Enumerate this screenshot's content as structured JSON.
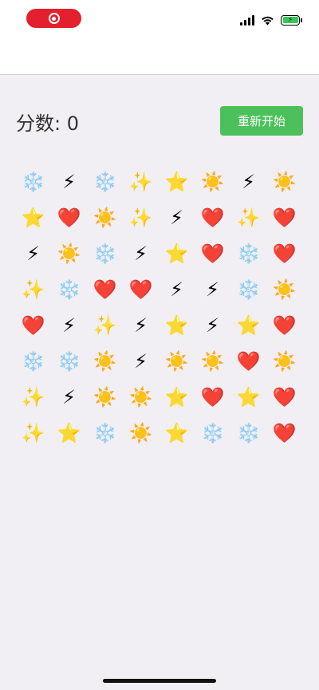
{
  "statusbar": {
    "record_icon": "record-circle-icon",
    "signal_icon": "cellular-signal-icon",
    "wifi_icon": "wifi-icon",
    "battery_icon": "battery-charging-icon",
    "battery_color": "#34c759"
  },
  "header": {
    "score_label": "分数: 0",
    "restart_label": "重新开始",
    "restart_color": "#4cc15b"
  },
  "board": {
    "rows": [
      [
        "❄️",
        "⚡",
        "❄️",
        "✨",
        "⭐",
        "☀️",
        "⚡",
        "☀️"
      ],
      [
        "⭐",
        "❤️",
        "☀️",
        "✨",
        "⚡",
        "❤️",
        "✨",
        "❤️"
      ],
      [
        "⚡",
        "☀️",
        "❄️",
        "⚡",
        "⭐",
        "❤️",
        "❄️",
        "❤️"
      ],
      [
        "✨",
        "❄️",
        "❤️",
        "❤️",
        "⚡",
        "⚡",
        "❄️",
        "☀️"
      ],
      [
        "❤️",
        "⚡",
        "✨",
        "⚡",
        "⭐",
        "⚡",
        "⭐",
        "❤️"
      ],
      [
        "❄️",
        "❄️",
        "☀️",
        "⚡",
        "☀️",
        "☀️",
        "❤️",
        "☀️"
      ],
      [
        "✨",
        "⚡",
        "☀️",
        "☀️",
        "⭐",
        "❤️",
        "⭐",
        "❤️"
      ],
      [
        "✨",
        "⭐",
        "❄️",
        "☀️",
        "⭐",
        "❄️",
        "❄️",
        "❤️"
      ]
    ]
  }
}
